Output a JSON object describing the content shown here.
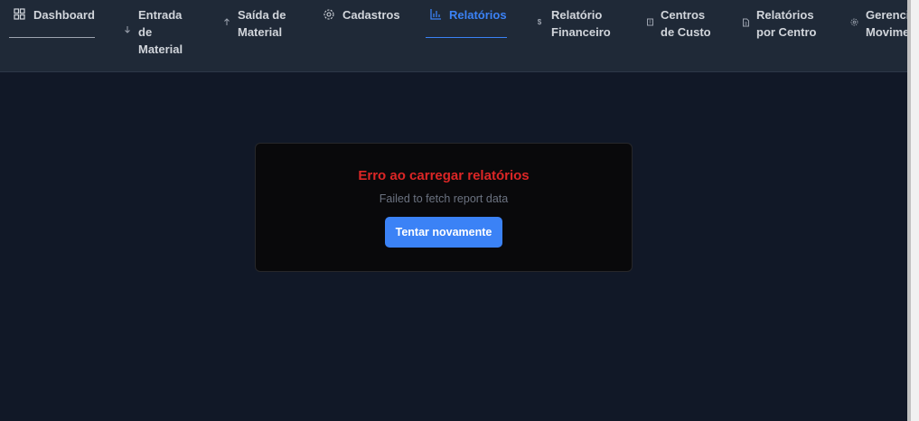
{
  "nav": {
    "items": [
      {
        "label": "Dashboard",
        "icon": "grid-icon"
      },
      {
        "label": "Entrada\nde\nMaterial",
        "icon": "arrow-down-icon"
      },
      {
        "label": "Saída de\nMaterial",
        "icon": "arrow-up-icon"
      },
      {
        "label": "Cadastros",
        "icon": "gear-icon"
      },
      {
        "label": "Relatórios",
        "icon": "bar-chart-icon"
      },
      {
        "label": "Relatório\nFinanceiro",
        "icon": "dollar-icon"
      },
      {
        "label": "Centros\nde Custo",
        "icon": "building-icon"
      },
      {
        "label": "Relatórios\npor Centro",
        "icon": "document-icon"
      },
      {
        "label": "Gerenciar\nMovimentações",
        "icon": "gear-icon"
      }
    ],
    "active": "Relatórios"
  },
  "error": {
    "title": "Erro ao carregar relatórios",
    "message": "Failed to fetch report data",
    "retry_label": "Tentar novamente"
  },
  "colors": {
    "background": "#111827",
    "nav_background": "#1f2937",
    "active": "#3b82f6",
    "error": "#dc2626",
    "card": "#09090b"
  }
}
